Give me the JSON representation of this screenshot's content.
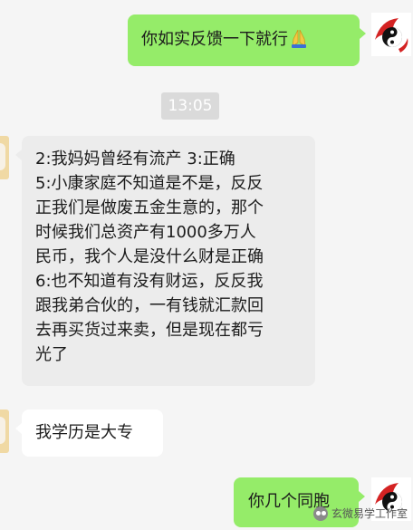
{
  "messages": [
    {
      "side": "right",
      "text": "你如实反馈一下就行",
      "emoji": "folded-hands"
    },
    {
      "side": "center",
      "timestamp": "13:05"
    },
    {
      "side": "left",
      "lines": [
        "2:我妈妈曾经有流产 3:正确",
        "5:小康家庭不知道是不是，反反",
        "正我们是做废五金生意的，那个",
        "时候我们总资产有1000多万人",
        "民币，我个人是没什么财是正确",
        "6:也不知道有没有财运，反反我",
        "跟我弟合伙的，一有钱就汇款回",
        "去再买货过来卖，但是现在都亏",
        "光了"
      ]
    },
    {
      "side": "left",
      "text": "我学历是大专"
    },
    {
      "side": "right",
      "text": "你几个同胞"
    }
  ],
  "watermark": "玄微易学工作室",
  "colors": {
    "sent_bubble": "#95ec69",
    "background": "#f5f5f5"
  }
}
